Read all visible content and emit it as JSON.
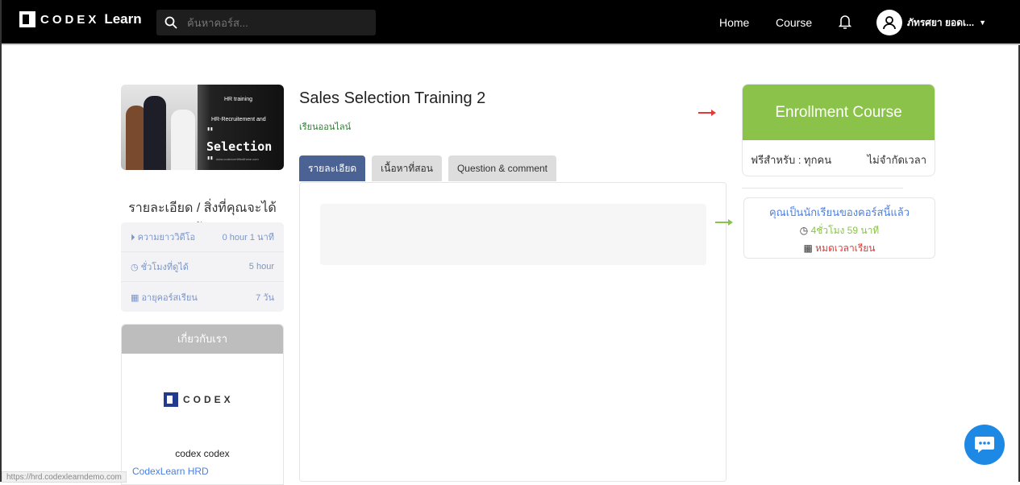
{
  "nav": {
    "logo_text": "CODEX",
    "logo_suffix": "Learn",
    "search_placeholder": "ค้นหาคอร์ส...",
    "home": "Home",
    "course": "Course",
    "user_name": "ภัทรศยา ยอดเ..."
  },
  "course": {
    "thumbnail": {
      "line1": "HR training",
      "line2": "HR-Recruitement and",
      "line3": "\" Selection \"",
      "line4": "www.codexcertifiedthese.com"
    },
    "title": "Sales Selection Training 2",
    "type": "เรียนออนไลน์",
    "tabs": [
      "รายละเอียด",
      "เนื้อหาที่สอน",
      "Question & comment"
    ]
  },
  "sidebar": {
    "title": "รายละเอียด / สิ่งที่คุณจะได้รับ",
    "stats": [
      {
        "label": "ความยาววิดีโอ",
        "value": "0 hour 1 นาที"
      },
      {
        "label": "ชั่วโมงที่ดูได้",
        "value": "5 hour"
      },
      {
        "label": "อายุคอร์สเรียน",
        "value": "7 วัน"
      }
    ],
    "about_title": "เกี่ยวกับเรา",
    "about_logo": "CODEX",
    "about_name": "codex codex",
    "about_link": "CodexLearn HRD"
  },
  "enroll": {
    "button": "Enrollment Course",
    "free_for": "ฟรีสำหรับ : ทุกคน",
    "duration": "ไม่จำกัดเวลา"
  },
  "status": {
    "enrolled": "คุณเป็นนักเรียนของคอร์สนี้แล้ว",
    "time_left": "4ชั่วโมง 59 นาที",
    "expired": "หมดเวลาเรียน"
  },
  "status_url": "https://hrd.codexlearndemo.com",
  "colors": {
    "green": "#8bc34a",
    "blue": "#4a7fe0",
    "red": "#e53935",
    "tab_active": "#4a6394"
  }
}
